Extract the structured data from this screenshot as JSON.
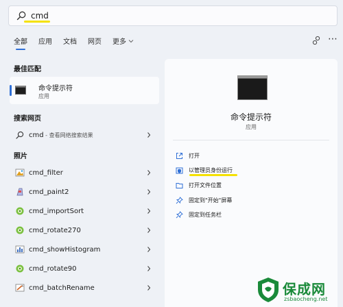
{
  "search": {
    "value": "cmd"
  },
  "tabs": [
    {
      "label": "全部",
      "active": true
    },
    {
      "label": "应用"
    },
    {
      "label": "文档"
    },
    {
      "label": "网页"
    },
    {
      "label": "更多"
    }
  ],
  "best_match": {
    "heading": "最佳匹配",
    "title": "命令提示符",
    "subtitle": "应用"
  },
  "web_search": {
    "heading": "搜索网页",
    "query": "cmd",
    "hint": " - 查看网络搜索结果"
  },
  "photos": {
    "heading": "照片",
    "items": [
      {
        "label": "cmd_filter",
        "icon": "filter-photo-icon"
      },
      {
        "label": "cmd_paint2",
        "icon": "paint-photo-icon"
      },
      {
        "label": "cmd_importSort",
        "icon": "import-photo-icon"
      },
      {
        "label": "cmd_rotate270",
        "icon": "rotate-photo-icon"
      },
      {
        "label": "cmd_showHistogram",
        "icon": "histogram-photo-icon"
      },
      {
        "label": "cmd_rotate90",
        "icon": "rotate-photo-icon"
      },
      {
        "label": "cmd_batchRename",
        "icon": "rename-photo-icon"
      }
    ]
  },
  "detail": {
    "name": "命令提示符",
    "type": "应用",
    "actions": [
      {
        "label": "打开",
        "icon": "open-icon"
      },
      {
        "label": "以管理员身份运行",
        "icon": "admin-shield-icon"
      },
      {
        "label": "打开文件位置",
        "icon": "folder-icon"
      },
      {
        "label": "固定到\"开始\"屏幕",
        "icon": "pin-icon"
      },
      {
        "label": "固定到任务栏",
        "icon": "pin-icon"
      }
    ]
  },
  "watermark": {
    "brand": "保成网",
    "url": "zsbaocheng.net"
  },
  "colors": {
    "accent": "#2f6fd6",
    "highlight": "#f5e100",
    "watermark": "#1a8a3a"
  }
}
